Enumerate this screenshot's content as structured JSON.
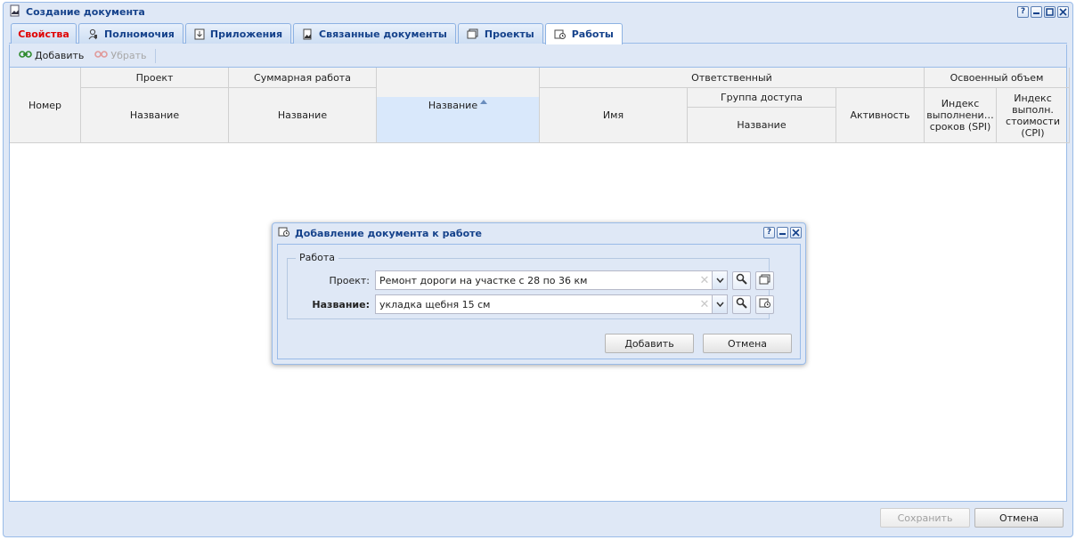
{
  "window": {
    "title": "Создание документа",
    "tool_icons": [
      "help-icon",
      "minimize-icon",
      "maximize-icon",
      "close-icon"
    ],
    "help_glyph": "?"
  },
  "tabs": [
    {
      "label": "Свойства",
      "icon": "",
      "color": "#e00000"
    },
    {
      "label": "Полномочия",
      "icon": "user-key-icon"
    },
    {
      "label": "Приложения",
      "icon": "attachment-icon"
    },
    {
      "label": "Связанные документы",
      "icon": "linked-docs-icon"
    },
    {
      "label": "Проекты",
      "icon": "projects-icon"
    },
    {
      "label": "Работы",
      "icon": "works-icon",
      "active": true
    }
  ],
  "toolbar": {
    "add_label": "Добавить",
    "remove_label": "Убрать"
  },
  "grid": {
    "headers": {
      "number": "Номер",
      "project": "Проект",
      "project_name": "Название",
      "summary": "Суммарная работа",
      "summary_name": "Название",
      "name": "Название",
      "responsible": "Ответственный",
      "resp_name": "Имя",
      "access_group": "Группа доступа",
      "access_group_name": "Название",
      "activity": "Активность",
      "earned": "Освоенный объем",
      "spi": "Индекс выполнени… сроков (SPI)",
      "cpi": "Индекс выполн. стоимости (CPI)"
    },
    "rows": []
  },
  "footer": {
    "save_label": "Сохранить",
    "cancel_label": "Отмена"
  },
  "dialog": {
    "title": "Добавление документа к работе",
    "legend": "Работа",
    "project_label": "Проект:",
    "project_value": "Ремонт дороги на участке с 28 по 36 км",
    "name_label": "Название:",
    "name_value": "укладка щебня 15 см",
    "add_label": "Добавить",
    "cancel_label": "Отмена",
    "help_glyph": "?"
  },
  "colors": {
    "accent": "#15428b",
    "border": "#99bbe8",
    "panel_bg": "#dfe8f6",
    "required_tab": "#e00000"
  }
}
